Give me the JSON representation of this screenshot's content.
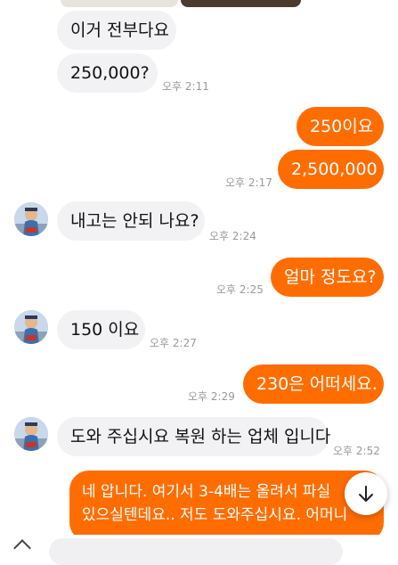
{
  "messages": {
    "m1": {
      "text": "이거 전부다요"
    },
    "m2": {
      "text": "250,000?",
      "time": "오후 2:11"
    },
    "m3": {
      "text": "250이요"
    },
    "m4": {
      "text": "2,500,000",
      "time": "오후 2:17"
    },
    "m5": {
      "text": "내고는 안되 나요?",
      "time": "오후 2:24"
    },
    "m6": {
      "text": "얼마 정도요?",
      "time": "오후 2:25"
    },
    "m7": {
      "text": "150 이요",
      "time": "오후 2:27"
    },
    "m8": {
      "text": "230은 어떠세요.",
      "time": "오후 2:29"
    },
    "m9": {
      "text": "도와 주십시요 복원 하는 업체 입니다",
      "time": "오후 2:52"
    },
    "m10": {
      "line1": "네 압니다. 여기서 3-4배는 올려서 파실",
      "line2": "있으실텐데요.. 저도 도와주십시요. 어머니"
    }
  },
  "colors": {
    "outgoing": "#ff6d00",
    "incoming": "#f2f2f5",
    "timestamp": "#9a9a9a"
  },
  "icons": {
    "scroll_down": "arrow-down-icon",
    "avatar": "avatar-icon"
  }
}
